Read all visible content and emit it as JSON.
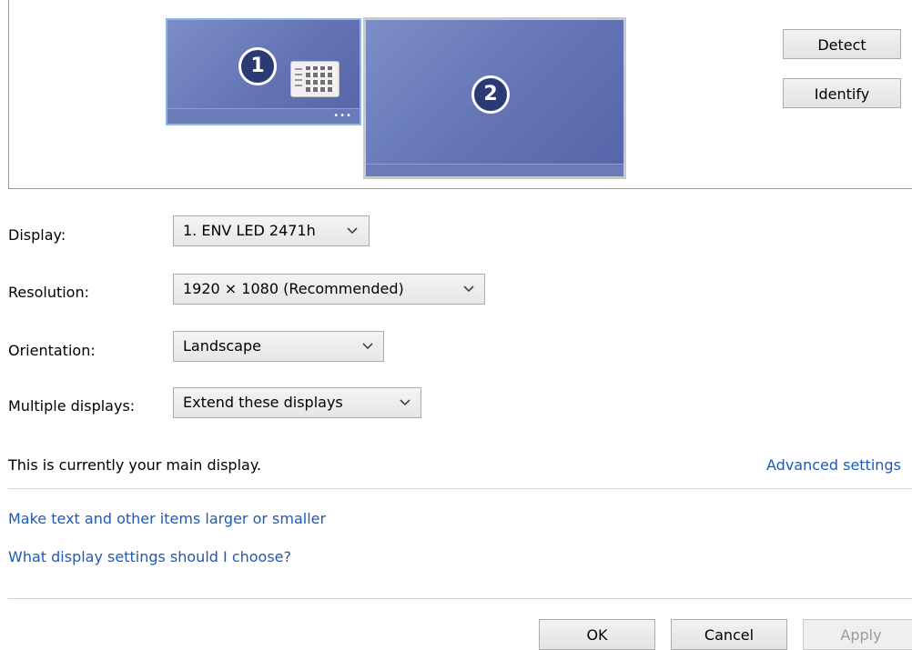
{
  "arrangement": {
    "monitors": [
      {
        "number": "1",
        "selected": true
      },
      {
        "number": "2",
        "selected": false
      }
    ],
    "detect_label": "Detect",
    "identify_label": "Identify"
  },
  "form": {
    "display": {
      "label": "Display:",
      "value": "1. ENV LED 2471h"
    },
    "resolution": {
      "label": "Resolution:",
      "value": "1920 × 1080 (Recommended)"
    },
    "orientation": {
      "label": "Orientation:",
      "value": "Landscape"
    },
    "multiple": {
      "label": "Multiple displays:",
      "value": "Extend these displays"
    }
  },
  "status_text": "This is currently your main display.",
  "advanced_link": "Advanced settings",
  "links": {
    "text_size": "Make text and other items larger or smaller",
    "help": "What display settings should I choose?"
  },
  "footer": {
    "ok_label": "OK",
    "cancel_label": "Cancel",
    "apply_label": "Apply"
  },
  "colors": {
    "monitor_fill": "#6373b4",
    "link": "#1e5ab4",
    "selection_border": "#8fb7e6"
  },
  "icons": [
    "chevron-down-icon",
    "display-settings-icon"
  ]
}
